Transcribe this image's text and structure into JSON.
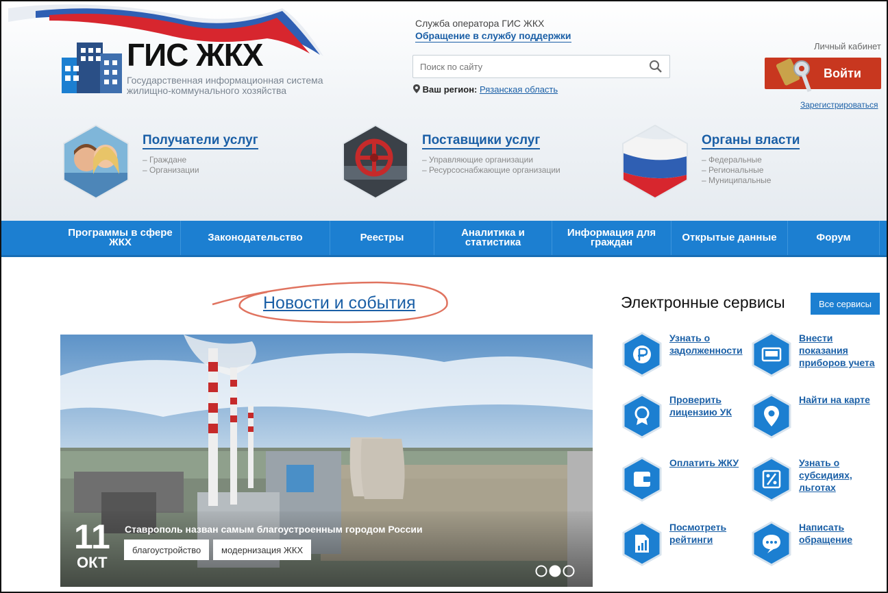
{
  "header": {
    "logo_title": "ГИС ЖКХ",
    "logo_subtitle": "Государственная информационная система жилищно-коммунального хозяйства",
    "operator_text": "Служба оператора ГИС ЖКХ",
    "support_link": "Обращение в службу поддержки",
    "search_placeholder": "Поиск по сайту",
    "region_label": "Ваш регион:",
    "region_value": "Рязанская область",
    "cabinet_label": "Личный кабинет",
    "login_label": "Войти",
    "register_link": "Зарегистрироваться"
  },
  "categories": [
    {
      "title": "Получатели услуг",
      "items": [
        "– Граждане",
        "– Организации"
      ]
    },
    {
      "title": "Поставщики услуг",
      "items": [
        "– Управляющие организации",
        "– Ресурсоснабжающие организации"
      ]
    },
    {
      "title": "Органы власти",
      "items": [
        "– Федеральные",
        "– Региональные",
        "– Муниципальные"
      ]
    }
  ],
  "nav": [
    "Программы в сфере ЖКХ",
    "Законодательство",
    "Реестры",
    "Аналитика и статистика",
    "Информация для граждан",
    "Открытые данные",
    "Форум"
  ],
  "news": {
    "section_title": "Новости и события",
    "day": "11",
    "month": "окт",
    "headline": "Ставрополь назван самым благоустроенным городом России",
    "tags": [
      "благоустройство",
      "модернизация ЖКХ"
    ],
    "slides": 3,
    "active_slide": 2
  },
  "services": {
    "title": "Электронные сервисы",
    "all_button": "Все сервисы",
    "items": [
      {
        "label": "Узнать о задолженности",
        "icon": "ruble-icon"
      },
      {
        "label": "Внести показания приборов учета",
        "icon": "meter-icon"
      },
      {
        "label": "Проверить лицензию УК",
        "icon": "license-badge-icon"
      },
      {
        "label": "Найти на карте",
        "icon": "map-pin-icon"
      },
      {
        "label": "Оплатить ЖКУ",
        "icon": "wallet-icon"
      },
      {
        "label": "Узнать о субсидиях, льготах",
        "icon": "percent-icon"
      },
      {
        "label": "Посмотреть рейтинги",
        "icon": "rating-chart-icon"
      },
      {
        "label": "Написать обращение",
        "icon": "chat-bubble-icon"
      }
    ]
  },
  "colors": {
    "brand_blue": "#1c7fd1",
    "link_blue": "#1a5fa6",
    "login_red": "#c8371f"
  }
}
